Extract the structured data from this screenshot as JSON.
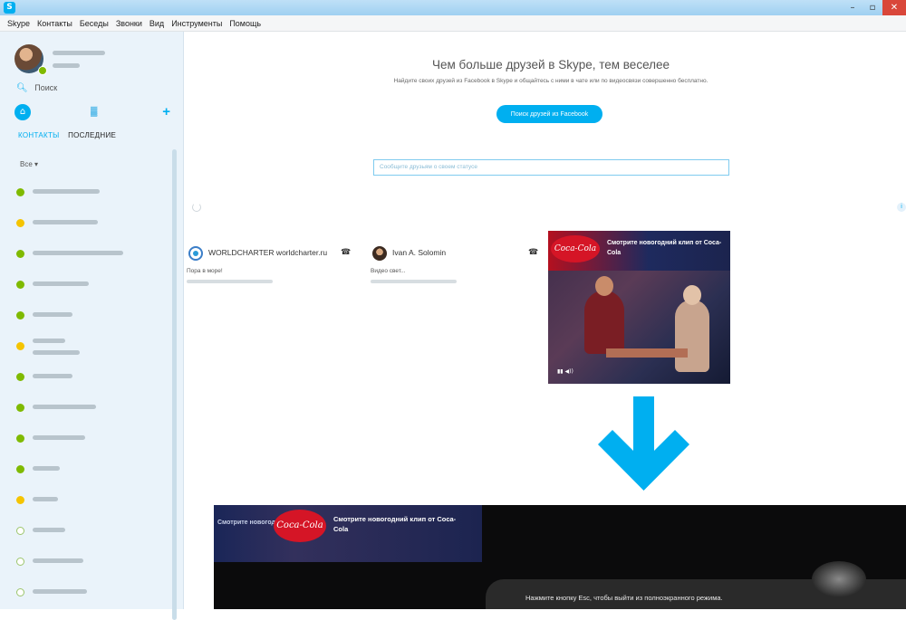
{
  "window": {
    "app_icon": "S",
    "controls": {
      "minimize": "–",
      "restore": "▫",
      "close": "✕"
    }
  },
  "menu": [
    "Skype",
    "Контакты",
    "Беседы",
    "Звонки",
    "Вид",
    "Инструменты",
    "Помощь"
  ],
  "sidebar": {
    "search_placeholder": "Поиск",
    "tabs": {
      "contacts": "КОНТАКТЫ",
      "recent": "ПОСЛЕДНИЕ"
    },
    "filter": "Все ▾",
    "contacts": [
      {
        "status": "online",
        "w": 74
      },
      {
        "status": "away",
        "w": 72
      },
      {
        "status": "online",
        "w": 100
      },
      {
        "status": "online",
        "w": 62
      },
      {
        "status": "online",
        "w": 44
      },
      {
        "status": "away",
        "w": 36,
        "w2": 52
      },
      {
        "status": "online",
        "w": 44
      },
      {
        "status": "online",
        "w": 70
      },
      {
        "status": "online",
        "w": 58
      },
      {
        "status": "online",
        "w": 30
      },
      {
        "status": "away",
        "w": 28
      },
      {
        "status": "offline",
        "w": 36
      },
      {
        "status": "offline",
        "w": 56
      },
      {
        "status": "offline",
        "w": 60
      }
    ]
  },
  "main": {
    "headline": "Чем больше друзей в Skype, тем веселее",
    "subtext": "Найдите своих друзей из Facebook в Skype и общайтесь с ними в чате или по видеосвязи совершенно бесплатно.",
    "find_button": "Поиск друзей из Facebook",
    "message_placeholder": "Сообщите друзьям о своем статусе",
    "cards": [
      {
        "name": "WORLDCHARTER worldcharter.ru",
        "message": "Пора в море!"
      },
      {
        "name": "Ivan A. Solomin",
        "message": "Видео свет..."
      }
    ]
  },
  "ad": {
    "brand": "Coca-Cola",
    "headline": "Смотрите новогодний клип от Coca-Cola",
    "controls": "▮▮ ◀))"
  },
  "video": {
    "left_text": "Смотрите новогодний клип",
    "overlay_text": "Нажмите кнопку Esc, чтобы выйти из полноэкранного режима."
  },
  "colors": {
    "skype_blue": "#00aff0",
    "online": "#7fba00",
    "away": "#f5c400",
    "close_red": "#d9473a"
  },
  "icons": [
    "skype-icon",
    "search-icon",
    "home-icon",
    "dialpad-icon",
    "plus-icon",
    "call-icon",
    "arrow-down-icon"
  ]
}
